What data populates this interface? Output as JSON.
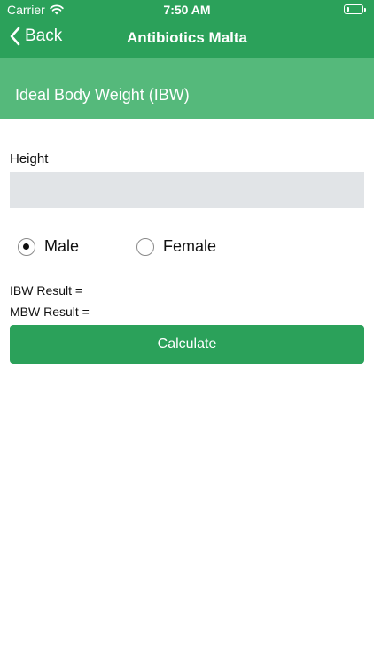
{
  "status_bar": {
    "carrier": "Carrier",
    "time": "7:50 AM",
    "battery_level": 0.2
  },
  "nav": {
    "back_label": "Back",
    "title": "Antibiotics Malta"
  },
  "section": {
    "title": "Ideal Body Weight (IBW)"
  },
  "form": {
    "height_label": "Height",
    "height_value": "",
    "height_placeholder": "",
    "gender_options": [
      {
        "label": "Male",
        "selected": true
      },
      {
        "label": "Female",
        "selected": false
      }
    ],
    "ibw_result": "IBW Result =",
    "mbw_result": "MBW Result =",
    "calculate_label": "Calculate"
  },
  "colors": {
    "primary": "#2ba15a",
    "header": "#55b97b",
    "input_bg": "#e1e4e7"
  },
  "icons": {
    "back": "chevron-left-icon",
    "wifi": "wifi-icon",
    "battery": "battery-icon"
  }
}
